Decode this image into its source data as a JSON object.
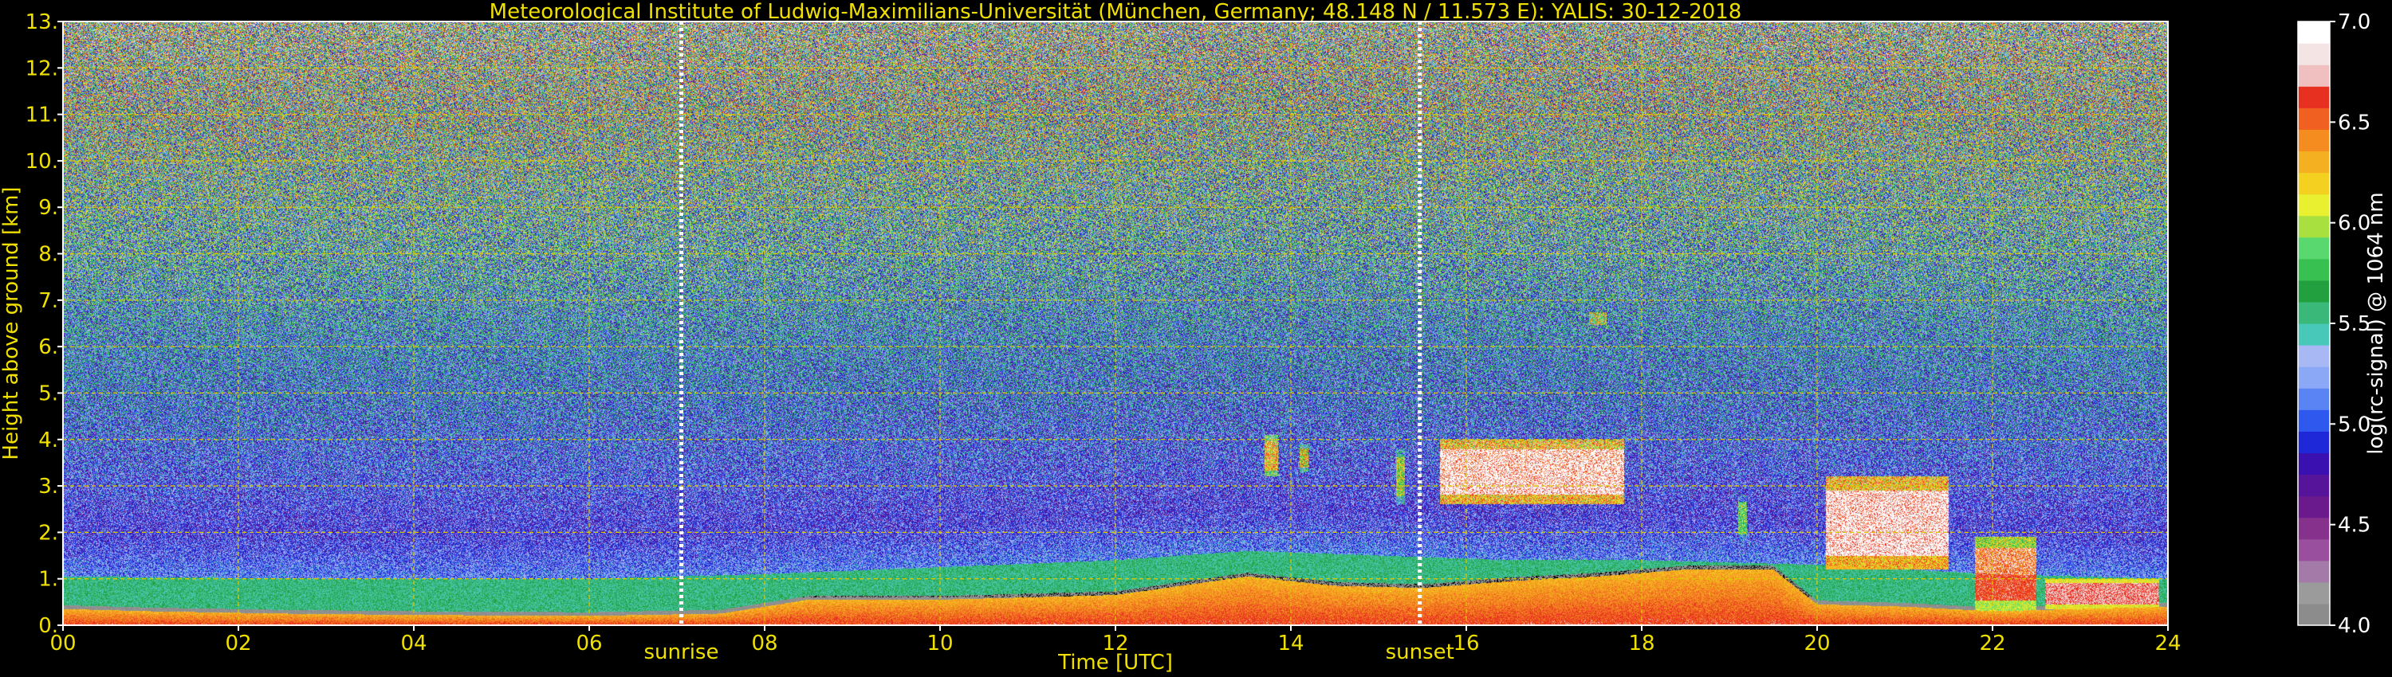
{
  "chart_data": {
    "type": "heatmap",
    "title": "Meteorological Institute of Ludwig-Maximilians-Universität (München, Germany; 48.148 N / 11.573 E):    YALIS: 30-12-2018",
    "xlabel": "Time [UTC]",
    "ylabel": "Height above ground [km]",
    "xlim": [
      0,
      24
    ],
    "ylim": [
      0,
      13
    ],
    "x_ticks": [
      {
        "value": 0,
        "label": "00"
      },
      {
        "value": 2,
        "label": "02"
      },
      {
        "value": 4,
        "label": "04"
      },
      {
        "value": 6,
        "label": "06"
      },
      {
        "value": 8,
        "label": "08"
      },
      {
        "value": 10,
        "label": "10"
      },
      {
        "value": 12,
        "label": "12"
      },
      {
        "value": 14,
        "label": "14"
      },
      {
        "value": 16,
        "label": "16"
      },
      {
        "value": 18,
        "label": "18"
      },
      {
        "value": 20,
        "label": "20"
      },
      {
        "value": 22,
        "label": "22"
      },
      {
        "value": 24,
        "label": "24"
      }
    ],
    "y_ticks": [
      {
        "value": 0,
        "label": "0."
      },
      {
        "value": 1,
        "label": "1."
      },
      {
        "value": 2,
        "label": "2."
      },
      {
        "value": 3,
        "label": "3."
      },
      {
        "value": 4,
        "label": "4."
      },
      {
        "value": 5,
        "label": "5."
      },
      {
        "value": 6,
        "label": "6."
      },
      {
        "value": 7,
        "label": "7."
      },
      {
        "value": 8,
        "label": "8."
      },
      {
        "value": 9,
        "label": "9."
      },
      {
        "value": 10,
        "label": "10."
      },
      {
        "value": 11,
        "label": "11."
      },
      {
        "value": 12,
        "label": "12."
      },
      {
        "value": 13,
        "label": "13."
      }
    ],
    "grid": true,
    "events": [
      {
        "label": "sunrise",
        "time": 7.05
      },
      {
        "label": "sunset",
        "time": 15.47
      }
    ],
    "colorbar": {
      "label": "log(rc-signal) @ 1064 nm",
      "range": [
        4.0,
        7.0
      ],
      "ticks": [
        {
          "value": 4.0,
          "label": "4.0"
        },
        {
          "value": 4.5,
          "label": "4.5"
        },
        {
          "value": 5.0,
          "label": "5.0"
        },
        {
          "value": 5.5,
          "label": "5.5"
        },
        {
          "value": 6.0,
          "label": "6.0"
        },
        {
          "value": 6.5,
          "label": "6.5"
        },
        {
          "value": 7.0,
          "label": "7.0"
        }
      ],
      "colors": [
        "#8c8c8c",
        "#9b9b9b",
        "#a37aa8",
        "#9a4f9e",
        "#86328c",
        "#6a1a8c",
        "#55149a",
        "#3a10b0",
        "#1e28d8",
        "#2f58ee",
        "#5a84f4",
        "#8aa8f6",
        "#a8b8f4",
        "#48c8b8",
        "#3ab87a",
        "#22a040",
        "#38c050",
        "#5ad870",
        "#a8e040",
        "#e8f030",
        "#f4d020",
        "#f4b020",
        "#f48c20",
        "#f06020",
        "#e83020",
        "#f0c0c0",
        "#f4e4e4",
        "#ffffff"
      ]
    },
    "features": {
      "dense_layer": [
        [
          0.0,
          0.35
        ],
        [
          1.0,
          0.3
        ],
        [
          2.5,
          0.25
        ],
        [
          4.0,
          0.22
        ],
        [
          6.0,
          0.2
        ],
        [
          7.5,
          0.25
        ],
        [
          8.5,
          0.55
        ],
        [
          10.0,
          0.55
        ],
        [
          12.0,
          0.65
        ],
        [
          13.5,
          1.05
        ],
        [
          14.5,
          0.85
        ],
        [
          15.5,
          0.8
        ],
        [
          16.5,
          0.95
        ],
        [
          17.5,
          1.05
        ],
        [
          18.5,
          1.2
        ],
        [
          19.5,
          1.2
        ],
        [
          20.0,
          0.45
        ],
        [
          21.0,
          0.4
        ],
        [
          22.0,
          0.3
        ],
        [
          23.0,
          0.35
        ],
        [
          24.0,
          0.4
        ]
      ],
      "mixed_layer_top": [
        [
          0.0,
          1.05
        ],
        [
          3.0,
          1.0
        ],
        [
          6.0,
          1.0
        ],
        [
          8.0,
          1.1
        ],
        [
          10.0,
          1.25
        ],
        [
          12.0,
          1.4
        ],
        [
          13.5,
          1.6
        ],
        [
          15.0,
          1.5
        ],
        [
          16.5,
          1.4
        ],
        [
          18.0,
          1.4
        ],
        [
          20.0,
          1.3
        ],
        [
          22.0,
          1.1
        ],
        [
          24.0,
          1.0
        ]
      ],
      "clouds": [
        {
          "t0": 15.7,
          "t1": 17.8,
          "base": 2.6,
          "top": 4.0,
          "level": 6.9
        },
        {
          "t0": 20.1,
          "t1": 21.5,
          "base": 1.2,
          "top": 3.2,
          "level": 6.9
        },
        {
          "t0": 21.8,
          "t1": 22.5,
          "base": 0.3,
          "top": 1.9,
          "level": 6.6
        },
        {
          "t0": 22.6,
          "t1": 23.9,
          "base": 0.35,
          "top": 1.0,
          "level": 6.7
        },
        {
          "t0": 13.7,
          "t1": 13.85,
          "base": 3.2,
          "top": 4.1,
          "level": 6.3
        },
        {
          "t0": 14.1,
          "t1": 14.2,
          "base": 3.3,
          "top": 3.9,
          "level": 6.1
        },
        {
          "t0": 15.2,
          "t1": 15.3,
          "base": 2.6,
          "top": 3.8,
          "level": 6.0
        },
        {
          "t0": 17.4,
          "t1": 17.6,
          "base": 6.4,
          "top": 6.8,
          "level": 5.9
        },
        {
          "t0": 19.1,
          "t1": 19.2,
          "base": 1.8,
          "top": 2.8,
          "level": 5.8
        }
      ]
    }
  }
}
